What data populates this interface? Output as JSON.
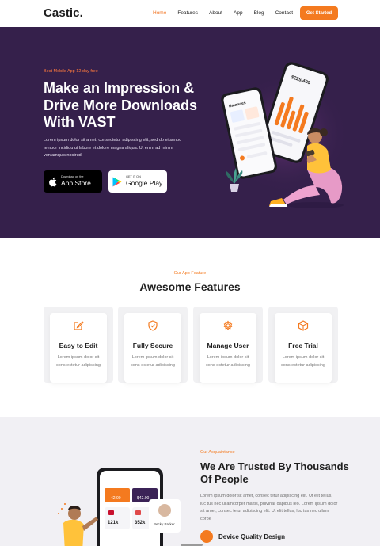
{
  "nav": {
    "logo": "Castic.",
    "links": [
      "Home",
      "Features",
      "About",
      "App",
      "Blog",
      "Contact"
    ],
    "cta": "Get Started",
    "active_color": "#f2711c"
  },
  "hero": {
    "kicker": "Best Mobile App 12 day free",
    "title": "Make an Impression & Drive More Downloads With VAST",
    "description": "Lorem ipsum dolor sit amet, consectetur adipiscing elit, sed do eiusmod tempor incididu ut labore et dolore magna aliqua. Ut enim ad minim veniamquis nostrud",
    "apple_small": "Download on the",
    "apple_big": "App Store",
    "google_small": "GET IT ON",
    "google_big": "Google Play",
    "bg_color": "#35204b",
    "phone_back_amount": "$225,400",
    "phone_front_label": "Balances"
  },
  "features": {
    "kicker": "Our App Feature",
    "title": "Awesome Features",
    "cards": [
      {
        "title": "Easy to Edit",
        "text": "Lorem ipsum dolor sit cons ectetur adipiscing",
        "icon": "edit-icon"
      },
      {
        "title": "Fully Secure",
        "text": "Lorem ipsum dolor sit cons ectetur adipiscing",
        "icon": "shield-check-icon"
      },
      {
        "title": "Manage User",
        "text": "Lorem ipsum dolor sit cons ectetur adipiscing",
        "icon": "gear-icon"
      },
      {
        "title": "Free Trial",
        "text": "Lorem ipsum dolor sit cons ectetur adipiscing",
        "icon": "cube-icon"
      }
    ]
  },
  "trusted": {
    "kicker": "Our Acquaintance",
    "title": "We Are Trusted By Thousands Of People",
    "text": "Lorem ipsum dolor sit amet, consec tetur adipiscing elit. Ut elit tellus, luc tus nec ullamcorper mattis, pulvinar dapibus leo. Lorem ipsum dolor sit amet, consec tetur adipiscing elit. Ut elit tellus, luc tus nec ullam corpe",
    "item_label": "Device Quality Design",
    "phone_stats": [
      "121k",
      "352k"
    ],
    "phone_cards": [
      "42.00",
      "$42.00"
    ],
    "profile_name": "Becky Parker"
  },
  "accent": "#f47a1f"
}
